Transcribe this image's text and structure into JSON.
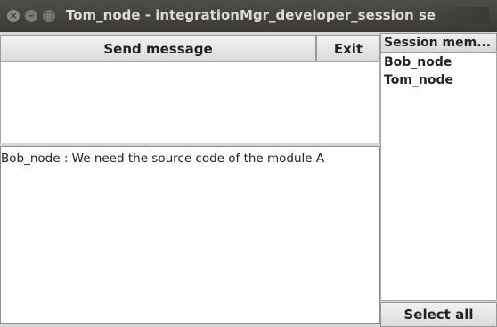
{
  "window": {
    "title": "Tom_node - integrationMgr_developer_session se"
  },
  "toolbar": {
    "send_label": "Send message",
    "exit_label": "Exit"
  },
  "chat": {
    "messages": [
      "Bob_node : We need the source code of the module A"
    ]
  },
  "sidebar": {
    "header": "Session mem...",
    "members": [
      "Bob_node",
      "Tom_node"
    ],
    "select_all_label": "Select all"
  }
}
